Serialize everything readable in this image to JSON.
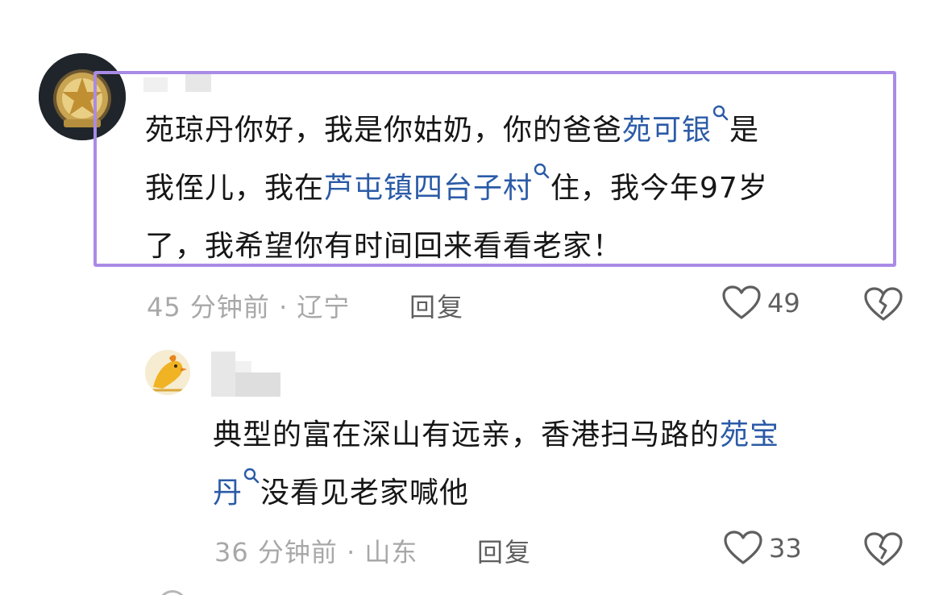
{
  "comments": [
    {
      "text": {
        "l1": "苑琼丹你好，我是你姑奶，你的爸爸",
        "l1_link": "苑可银",
        "l1_end": "是",
        "l2_start": "我侄儿，我在",
        "l2_link": "芦屯镇四台子村",
        "l2_end": "住，我今年97岁",
        "l3": "了，我希望你有时间回来看看老家！"
      },
      "meta": "45 分钟前 · 辽宁",
      "reply_label": "回复",
      "likes": "49"
    },
    {
      "text": {
        "l1_start": "典型的富在深山有远亲，香港扫马路的",
        "l1_link": "苑宝",
        "l2_link": "丹",
        "l2_end": "没看见老家喊他"
      },
      "meta": "36 分钟前 · 山东",
      "reply_label": "回复",
      "likes": "33"
    }
  ],
  "colors": {
    "highlight_border": "#a98be6",
    "link": "#2b5ba7",
    "meta": "#a8a8a8",
    "text": "#161616"
  }
}
